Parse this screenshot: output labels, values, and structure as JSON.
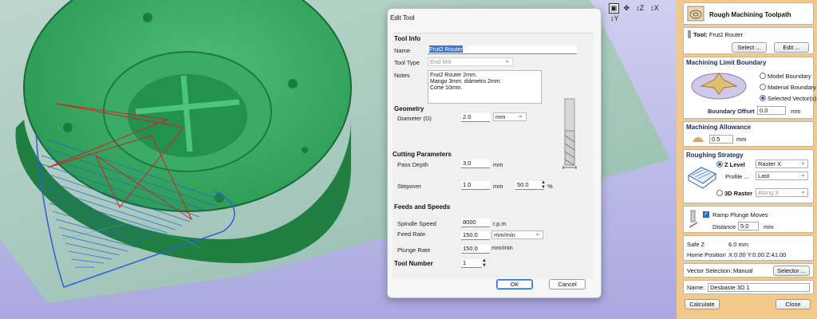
{
  "viewport": {
    "toolbar_icons": [
      "iso-view-icon",
      "pan-view-icon",
      "z-axis-view-icon",
      "x-axis-view-icon",
      "y-axis-view-icon"
    ],
    "toolbar_labels": [
      "▣",
      "✥",
      "↕Z",
      "↕X",
      "↕Y"
    ]
  },
  "panel": {
    "header": "Rough Machining Toolpath",
    "tool": {
      "label": "Tool:",
      "name": "Frut2 Router",
      "select_btn": "Select ...",
      "edit_btn": "Edit ..."
    },
    "boundary": {
      "title": "Machining Limit Boundary",
      "options": [
        "Model Boundary",
        "Material Boundary",
        "Selected Vector(s)"
      ],
      "selected": 2,
      "offset_label": "Boundary Offset",
      "offset_value": "0.0",
      "offset_unit": "mm"
    },
    "allowance": {
      "title": "Machining Allowance",
      "value": "0.5",
      "unit": "mm"
    },
    "strategy": {
      "title": "Roughing Strategy",
      "zlevel_label": "Z Level",
      "zlevel_select": "Raster X",
      "profile_label": "Profile ...",
      "profile_select": "Last",
      "raster3d_label": "3D Raster",
      "raster3d_select": "Along X"
    },
    "ramp": {
      "label": "Ramp Plunge Moves",
      "distance_label": "Distance",
      "distance_value": "5.0",
      "distance_unit": "mm"
    },
    "info": {
      "safez_label": "Safe Z",
      "safez_value": "6.0 mm",
      "home_label": "Home Position",
      "home_value": "X:0.00 Y:0.00 Z:41.00"
    },
    "vector_selection": {
      "label": "Vector Selection:",
      "value": "Manual",
      "btn": "Selector ..."
    },
    "name": {
      "label": "Name:",
      "value": "Desbaste 3D 1"
    },
    "calculate_btn": "Calculate",
    "close_btn": "Close"
  },
  "dialog": {
    "title": "Edit Tool",
    "tool_info": "Tool Info",
    "name_label": "Name",
    "name_value": "Frut2 Router",
    "type_label": "Tool Type",
    "type_value": "End Mill",
    "notes_label": "Notes",
    "notes_lines": [
      "Frut2 Router 2mm.",
      "Mango 3mm. diámetro 2mm.",
      "Corte 10mm."
    ],
    "geometry": "Geometry",
    "diameter_label": "Diameter (D)",
    "diameter_value": "2.0",
    "diameter_unit": "mm",
    "cutting": "Cutting Parameters",
    "pass_label": "Pass Depth",
    "pass_value": "3.0",
    "pass_unit": "mm",
    "stepover_label": "Stepover",
    "stepover_value": "1.0",
    "stepover_unit": "mm",
    "stepover_pct": "50.0",
    "pct_unit": "%",
    "feeds": "Feeds and Speeds",
    "spindle_label": "Spindle Speed",
    "spindle_value": "8000",
    "spindle_unit": "r.p.m",
    "feed_label": "Feed Rate",
    "feed_value": "150.0",
    "feed_unit": "mm/min",
    "plunge_label": "Plunge Rate",
    "plunge_value": "150.0",
    "plunge_unit": "mm/min",
    "toolnum_label": "Tool Number",
    "toolnum_value": "1",
    "ok_btn": "OK",
    "cancel_btn": "Cancel"
  }
}
